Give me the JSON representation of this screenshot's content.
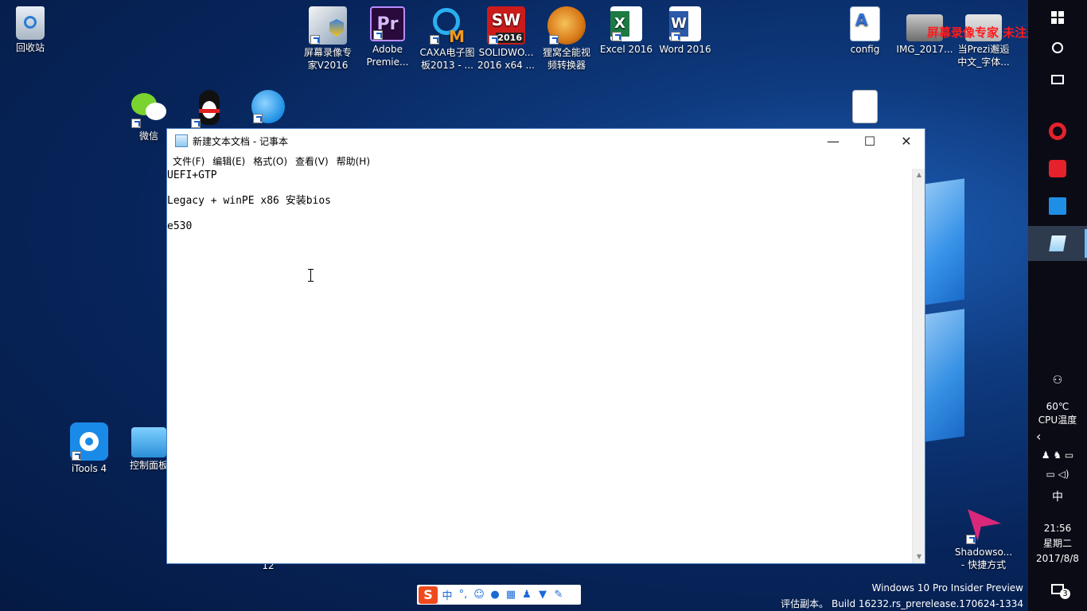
{
  "desktop": {
    "icons": [
      {
        "label": "回收站"
      },
      {
        "label_line1": "屏幕录像专",
        "label_line2": "家V2016"
      },
      {
        "label_line1": "Adobe",
        "label_line2": "Premie..."
      },
      {
        "label_line1": "CAXA电子图",
        "label_line2": "板2013 - ..."
      },
      {
        "label_line1": "SOLIDWO...",
        "label_line2": "2016 x64 ..."
      },
      {
        "label_line1": "狸窝全能视",
        "label_line2": "频转换器"
      },
      {
        "label": "Excel 2016"
      },
      {
        "label": "Word 2016"
      },
      {
        "label": "config"
      },
      {
        "label": "IMG_2017..."
      },
      {
        "label_line1": "当Prezi邂逅",
        "label_line2": "中文_字体..."
      },
      {
        "label": "微信"
      },
      {
        "label": "iTools 4"
      },
      {
        "label": "控制面板"
      },
      {
        "label_line1": "Shadowso...",
        "label_line2": "- 快捷方式"
      }
    ],
    "stray_text": "12",
    "watermark": "屏幕录像专家  未注册"
  },
  "notepad": {
    "title": "新建文本文档 - 记事本",
    "menu": [
      "文件(F)",
      "编辑(E)",
      "格式(O)",
      "查看(V)",
      "帮助(H)"
    ],
    "lines": [
      "UEFI+GTP",
      "",
      "Legacy + winPE x86 安装bios",
      "",
      "e530"
    ],
    "minimize": "—",
    "maximize": "☐",
    "close": "✕"
  },
  "taskbar": {
    "temp": "60℃",
    "temp_label": "CPU温度",
    "ime": "中",
    "time": "21:56",
    "weekday": "星期二",
    "date": "2017/8/8",
    "notification_count": "3"
  },
  "ime_bar": {
    "logo": "S",
    "mode": "中",
    "punct": "°,"
  },
  "system": {
    "edition": "Windows 10 Pro Insider Preview",
    "build": "评估副本。 Build 16232.rs_prerelease.170624-1334"
  },
  "colors": {
    "accent": "#76b9ed",
    "watermark": "#ff1a1a",
    "taskbar": "#0b0b16"
  }
}
